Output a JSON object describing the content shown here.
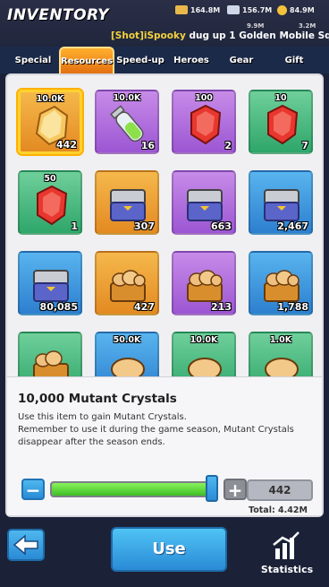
{
  "header": {
    "title": "INVENTORY",
    "resources": [
      {
        "value": "164.8M",
        "icon": "gold-bar-icon"
      },
      {
        "value": "156.7M",
        "icon": "wing-icon"
      },
      {
        "value": "84.9M",
        "icon": "coin-icon"
      }
    ],
    "sub_resources": [
      "9.9M",
      "3.2M"
    ],
    "ticker": {
      "name": "[Shot]iSpooky",
      "message": " dug up 1 Golden Mobile Squad w"
    }
  },
  "tabs": [
    {
      "label": "Special",
      "active": false
    },
    {
      "label": "Resources",
      "active": true
    },
    {
      "label": "Speed-up",
      "active": false
    },
    {
      "label": "Heroes",
      "active": false
    },
    {
      "label": "Gear",
      "active": false
    },
    {
      "label": "Gift",
      "active": false
    }
  ],
  "items": [
    {
      "top": "10.0K",
      "count": "442",
      "bg": "orange",
      "icon": "mutant-crystal-icon",
      "selected": true
    },
    {
      "top": "10.0K",
      "count": "16",
      "bg": "purple",
      "icon": "serum-vial-icon"
    },
    {
      "top": "100",
      "count": "2",
      "bg": "purple",
      "icon": "red-gem-icon"
    },
    {
      "top": "10",
      "count": "7",
      "bg": "green",
      "icon": "red-gem-icon"
    },
    {
      "top": "50",
      "count": "1",
      "bg": "green",
      "icon": "red-gem-icon"
    },
    {
      "top": "",
      "count": "307",
      "bg": "orange",
      "icon": "supply-crate-icon"
    },
    {
      "top": "",
      "count": "663",
      "bg": "purple",
      "icon": "supply-crate-icon"
    },
    {
      "top": "",
      "count": "2,467",
      "bg": "blue",
      "icon": "supply-crate-icon"
    },
    {
      "top": "",
      "count": "80,085",
      "bg": "blue",
      "icon": "supply-crate-icon"
    },
    {
      "top": "",
      "count": "427",
      "bg": "orange",
      "icon": "bread-basket-icon"
    },
    {
      "top": "",
      "count": "213",
      "bg": "purple",
      "icon": "bread-basket-icon"
    },
    {
      "top": "",
      "count": "1,788",
      "bg": "blue",
      "icon": "bread-basket-icon"
    },
    {
      "top": "",
      "count": "",
      "bg": "green",
      "icon": "bread-basket-icon"
    },
    {
      "top": "50.0K",
      "count": "",
      "bg": "blue",
      "icon": "bread-loaf-icon"
    },
    {
      "top": "10.0K",
      "count": "",
      "bg": "green",
      "icon": "bread-loaf-icon"
    },
    {
      "top": "1.0K",
      "count": "",
      "bg": "green",
      "icon": "bread-loaf-icon"
    }
  ],
  "detail": {
    "title": "10,000 Mutant Crystals",
    "line1": "Use this item to gain Mutant Crystals.",
    "line2": "Remember to use it during the game season, Mutant Crystals disappear after the season ends.",
    "quantity": "442",
    "total": "Total: 4.42M",
    "slider_fraction": 1.0
  },
  "actions": {
    "use_label": "Use",
    "stats_label": "Statistics"
  },
  "colors": {
    "orange": "#f0a23a",
    "purple": "#b070e0",
    "green": "#4cbc80",
    "blue": "#3f98e0",
    "accent": "#ffb02e"
  }
}
